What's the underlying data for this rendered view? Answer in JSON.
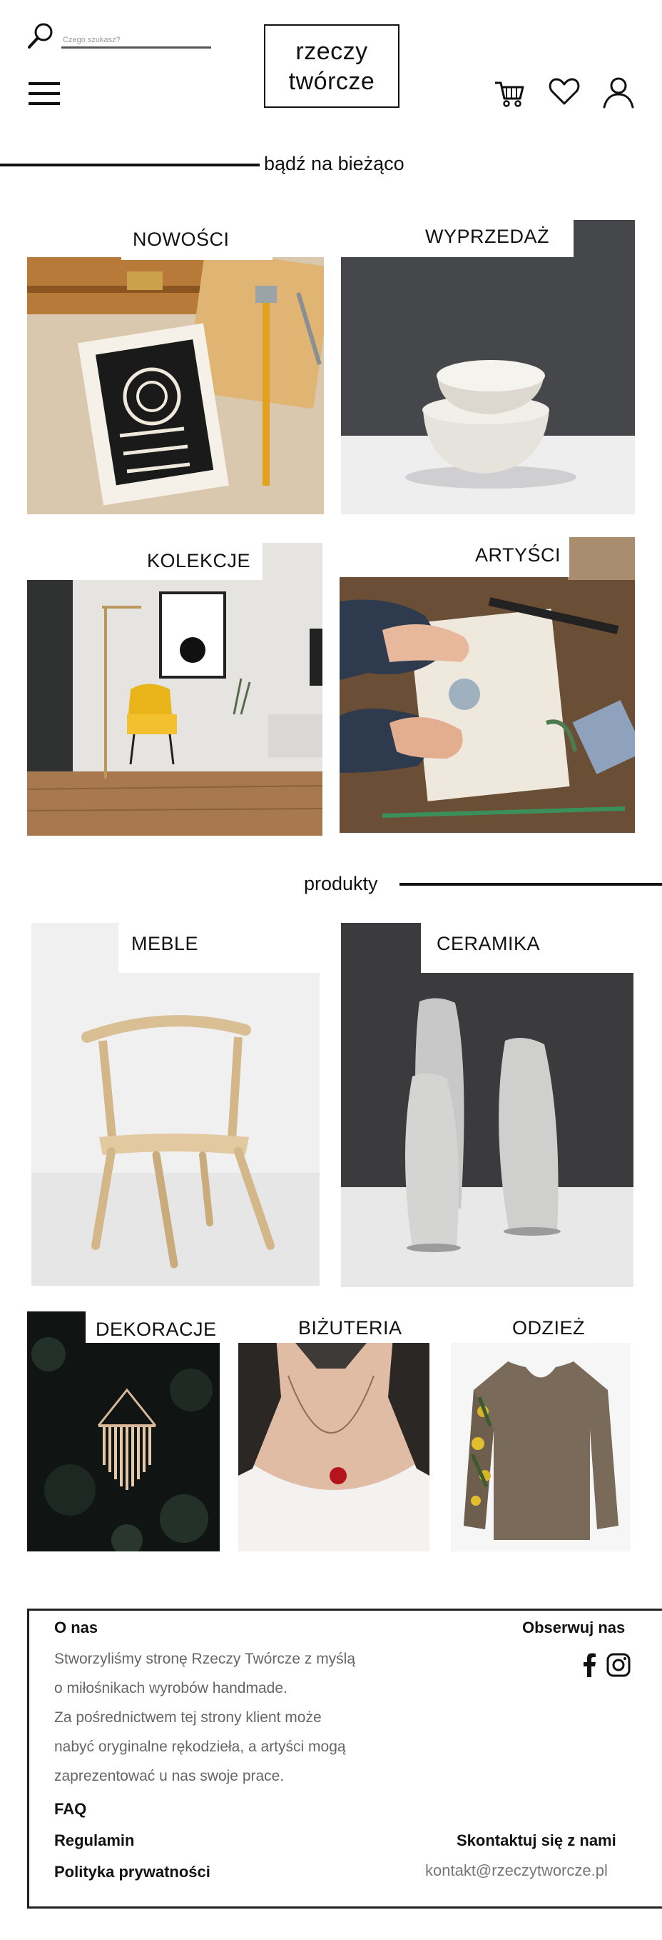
{
  "header": {
    "search": {
      "placeholder": "Czego szukasz?"
    },
    "logo": {
      "line1": "rzeczy",
      "line2": "twórcze"
    },
    "icons": [
      "search-icon",
      "menu-icon",
      "cart-icon",
      "heart-icon",
      "user-icon"
    ]
  },
  "sections": {
    "news_heading": "bądź na bieżąco",
    "products_heading": "produkty"
  },
  "news_tiles": [
    {
      "label": "NOWOŚCI"
    },
    {
      "label": "WYPRZEDAŻ"
    },
    {
      "label": "KOLEKCJE"
    },
    {
      "label": "ARTYŚCI"
    }
  ],
  "product_tiles": [
    {
      "label": "MEBLE"
    },
    {
      "label": "CERAMIKA"
    },
    {
      "label": "DEKORACJE"
    },
    {
      "label": "BIŻUTERIA"
    },
    {
      "label": "ODZIEŻ"
    }
  ],
  "footer": {
    "about_title": "O nas",
    "about_lines": [
      "Stworzyliśmy stronę Rzeczy Twórcze  z myślą",
      "o miłośnikach wyrobów handmade.",
      "Za pośrednictwem tej strony klient może",
      "nabyć oryginalne  rękodzieła, a artyści mogą",
      "zaprezentować u nas swoje prace."
    ],
    "follow_title": "Obserwuj nas",
    "social_icons": [
      "facebook-icon",
      "instagram-icon"
    ],
    "links": {
      "faq": "FAQ",
      "terms": "Regulamin",
      "privacy": "Polityka prywatności"
    },
    "contact_title": "Skontaktuj się z nami",
    "contact_email": "kontakt@rzeczytworcze.pl"
  },
  "colors": {
    "text": "#111111",
    "muted": "#666666",
    "background": "#ffffff",
    "line": "#111111"
  }
}
